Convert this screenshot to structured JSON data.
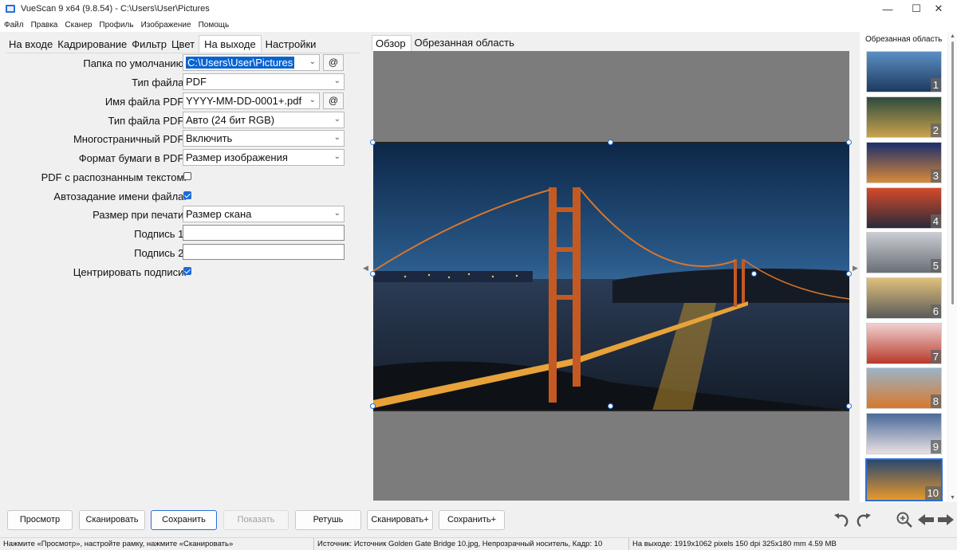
{
  "window": {
    "title": "VueScan 9 x64 (9.8.54) - C:\\Users\\User\\Pictures",
    "minimize_glyph": "—",
    "maximize_glyph": "☐",
    "close_glyph": "✕"
  },
  "menu": [
    "Файл",
    "Правка",
    "Сканер",
    "Профиль",
    "Изображение",
    "Помощь"
  ],
  "left_tabs": [
    "На входе",
    "Кадрирование",
    "Фильтр",
    "Цвет",
    "На выходе",
    "Настройки"
  ],
  "form": {
    "default_folder": {
      "label": "Папка по умолчанию:",
      "value": "C:\\Users\\User\\Pictures",
      "button": "@"
    },
    "file_type": {
      "label": "Тип файла:",
      "value": "PDF"
    },
    "pdf_file_name": {
      "label": "Имя файла PDF:",
      "value": "YYYY-MM-DD-0001+.pdf",
      "button": "@"
    },
    "pdf_file_type": {
      "label": "Тип файла PDF:",
      "value": "Авто (24 бит RGB)"
    },
    "multipage_pdf": {
      "label": "Многостраничный PDF:",
      "value": "Включить"
    },
    "pdf_paper_format": {
      "label": "Формат бумаги в PDF:",
      "value": "Размер изображения"
    },
    "pdf_ocr": {
      "label": "PDF с распознанным текстом:",
      "checked": false
    },
    "auto_file_name": {
      "label": "Автозадание имени файла:",
      "checked": true
    },
    "print_size": {
      "label": "Размер при печати:",
      "value": "Размер скана"
    },
    "caption1": {
      "label": "Подпись 1:",
      "value": ""
    },
    "caption2": {
      "label": "Подпись 2:",
      "value": ""
    },
    "center_captions": {
      "label": "Центрировать подписи:",
      "checked": true
    }
  },
  "preview_tabs": [
    "Обзор",
    "Обрезанная область"
  ],
  "right_panel": {
    "title": "Обрезанная область",
    "thumbs": [
      "1",
      "2",
      "3",
      "4",
      "5",
      "6",
      "7",
      "8",
      "9",
      "10"
    ],
    "active_index": 9
  },
  "buttons": {
    "preview": "Просмотр",
    "scan": "Сканировать",
    "save": "Сохранить",
    "show": "Показать",
    "retouch": "Ретушь",
    "scan_plus": "Сканировать+",
    "save_plus": "Сохранить+"
  },
  "status": {
    "left": "Нажмите «Просмотр», настройте рамку, нажмите «Сканировать»",
    "middle": "Источник: Источник Golden Gate Bridge 10.jpg, Непрозрачный носитель, Кадр: 10",
    "right": "На выходе: 1919x1062 pixels 150 dpi 325x180 mm 4.59 MB"
  },
  "colors": {
    "accent": "#2a6fd6",
    "selection": "#0a64d0",
    "preview_bg": "#7c7c7c"
  }
}
